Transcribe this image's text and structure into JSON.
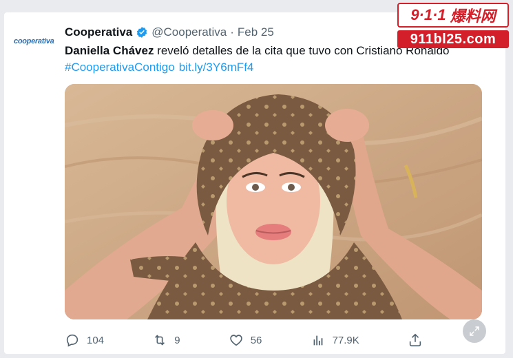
{
  "account": {
    "avatar_text": "cooperativa",
    "name": "Cooperativa",
    "handle": "@Cooperativa",
    "separator": "·",
    "date": "Feb 25"
  },
  "tweet": {
    "bold_name": "Daniella Chávez",
    "text": " reveló detalles de la cita que tuvo con Cristiano Ronaldo",
    "hashtag": "#CooperativaContigo",
    "link": "bit.ly/3Y6mFf4"
  },
  "actions": {
    "replies": "104",
    "retweets": "9",
    "likes": "56",
    "views": "77.9K"
  },
  "watermark": {
    "top_left": "9·1·1",
    "top_right": "爆料网",
    "bottom": "911bl25.com"
  },
  "colors": {
    "accent": "#1d9bf0",
    "text": "#0f1419",
    "muted": "#536471",
    "watermark_red": "#d21f2a"
  }
}
